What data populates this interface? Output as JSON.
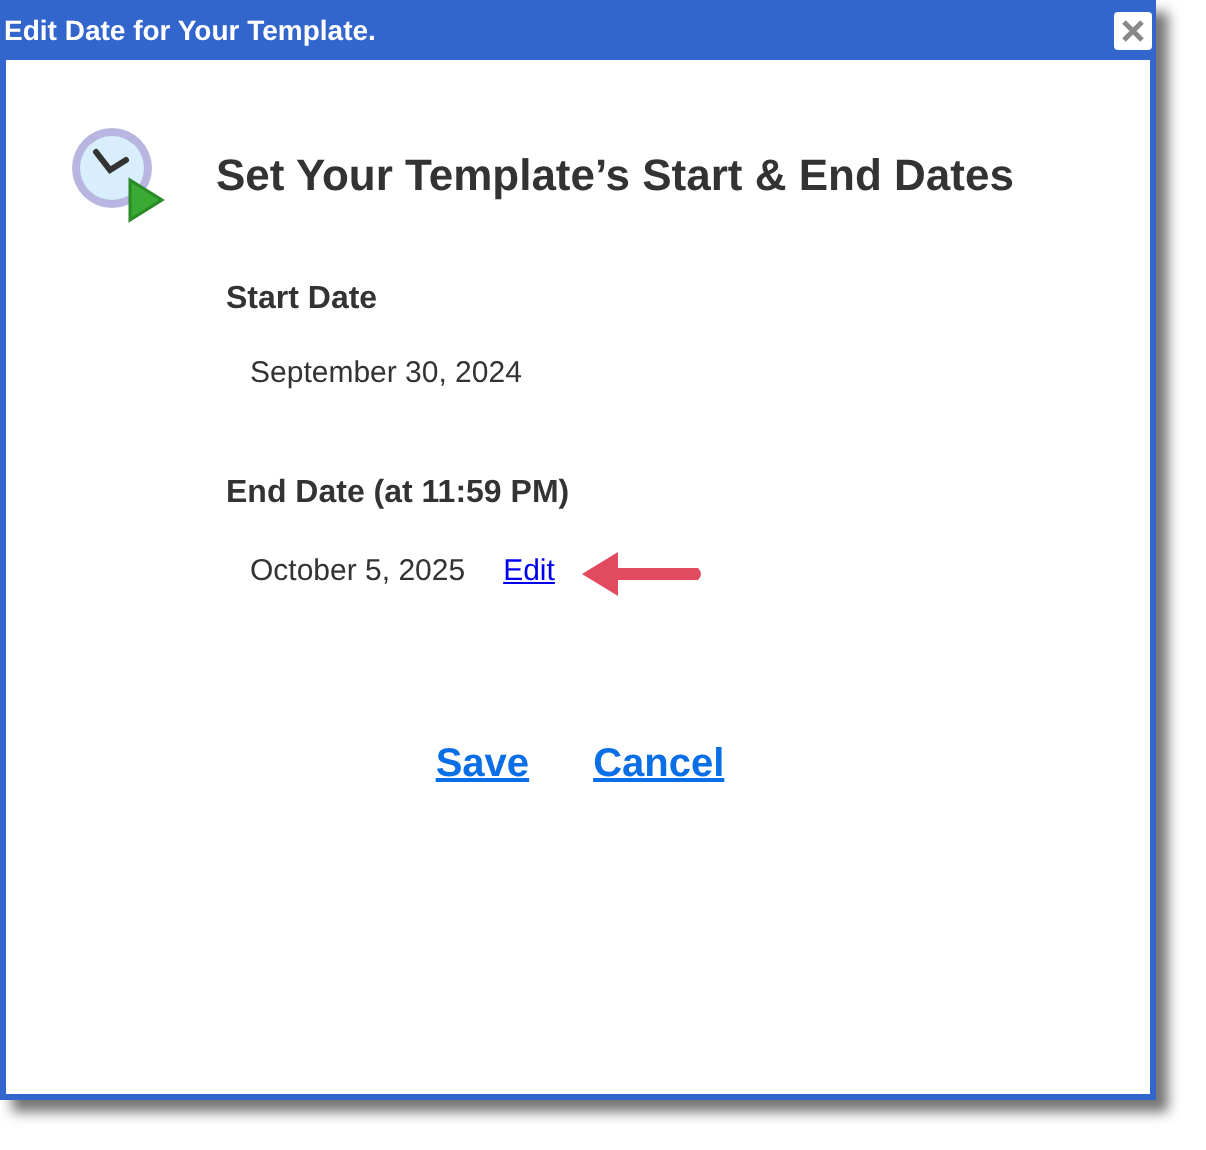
{
  "window": {
    "title": "Edit Date for Your Template."
  },
  "heading": "Set Your Template’s Start & End Dates",
  "start": {
    "label": "Start Date",
    "value": "September 30, 2024"
  },
  "end": {
    "label": "End Date (at 11:59 PM)",
    "value": "October 5, 2025",
    "link": "Edit"
  },
  "buttons": [
    "Save",
    "Cancel"
  ]
}
